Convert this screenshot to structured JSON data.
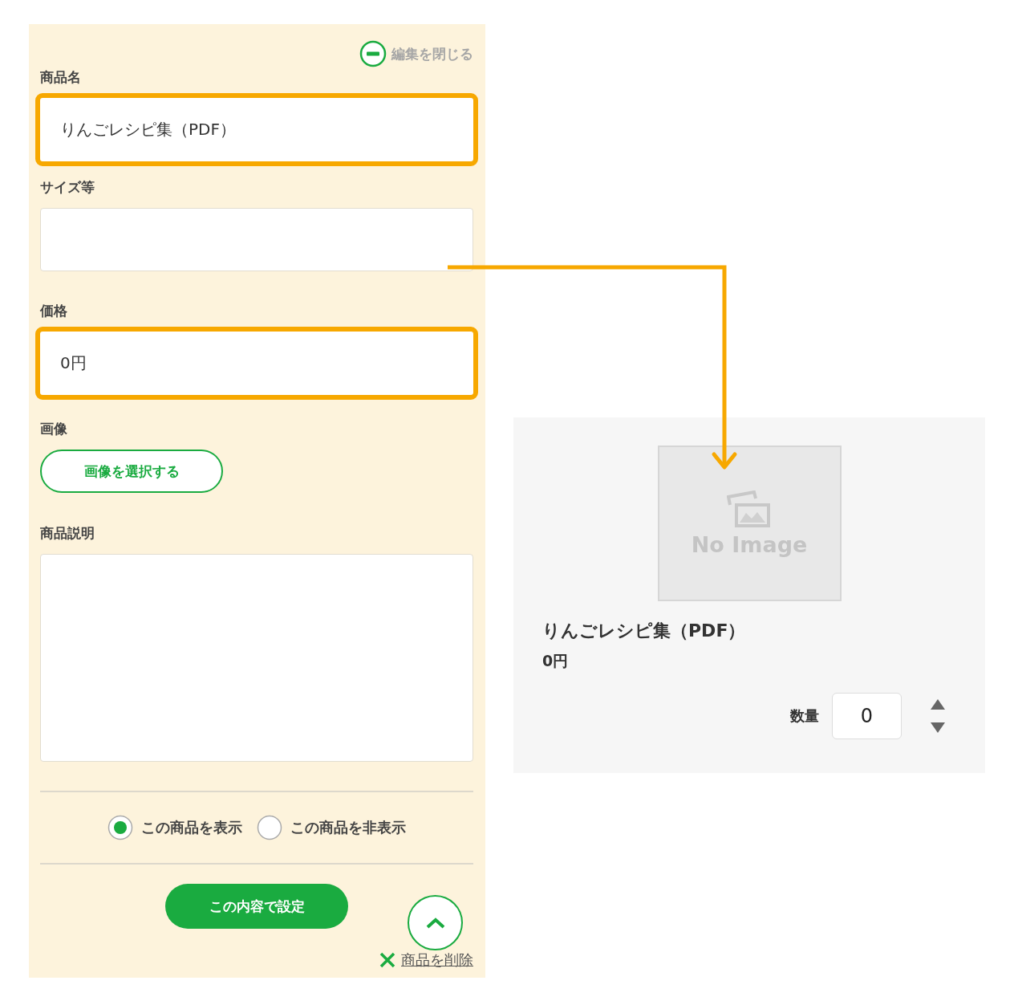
{
  "close_edit": "編集を閉じる",
  "fields": [
    {
      "kind": "text",
      "label": "商品名",
      "value": "りんごレシピ集（PDF）",
      "highlighted": true
    },
    {
      "kind": "text",
      "label": "サイズ等",
      "highlighted": false
    },
    {
      "kind": "text",
      "label": "価格",
      "value": "0円",
      "highlighted": true
    },
    {
      "kind": "image",
      "label": "画像",
      "button": "画像を選択する"
    },
    {
      "kind": "textarea",
      "label": "商品説明"
    }
  ],
  "visibility": [
    {
      "label": "この商品を表示",
      "selected": true
    },
    {
      "label": "この商品を非表示",
      "selected": false
    }
  ],
  "submit": "この内容で設定",
  "delete": "商品を削除",
  "preview": {
    "image_label": "No Image",
    "name": "りんごレシピ集（PDF）",
    "price": "0円",
    "quantity_label": "数量",
    "quantity": "0"
  }
}
